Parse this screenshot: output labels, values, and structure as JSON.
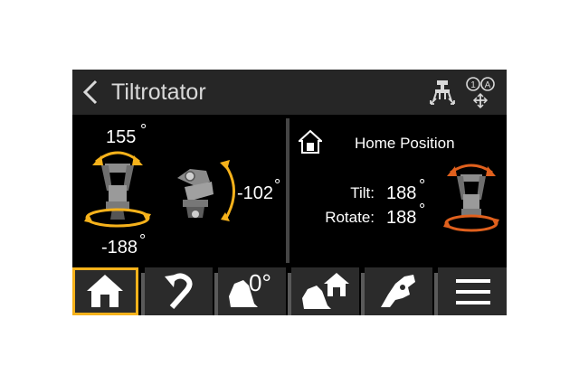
{
  "header": {
    "title": "Tiltrotator",
    "back_icon": "chevron-left-icon",
    "icons": [
      "tiltrotator-calibrate-icon",
      "axis-selection-icon"
    ],
    "icon_labels": [
      "1",
      "A"
    ]
  },
  "left_panel": {
    "tilt_top_value": "155",
    "tilt_side_value": "-102",
    "rotate_value": "-188",
    "degree_symbol": "°"
  },
  "right_panel": {
    "home_label": "Home Position",
    "tilt_label": "Tilt:",
    "tilt_value": "188",
    "rotate_label": "Rotate:",
    "rotate_value": "188",
    "degree_symbol": "°"
  },
  "toolbar": {
    "buttons": [
      {
        "icon": "home-icon",
        "active": true
      },
      {
        "icon": "undo-icon",
        "active": false
      },
      {
        "icon": "bucket-zero-icon",
        "label": "0°",
        "active": false
      },
      {
        "icon": "bucket-home-icon",
        "active": false
      },
      {
        "icon": "tool-icon",
        "active": false
      },
      {
        "icon": "menu-icon",
        "active": false
      }
    ]
  },
  "colors": {
    "accent": "#f6b21b",
    "arrow_orange": "#e0601d",
    "header_bg": "#262626",
    "button_bg": "#2b2b2b"
  }
}
